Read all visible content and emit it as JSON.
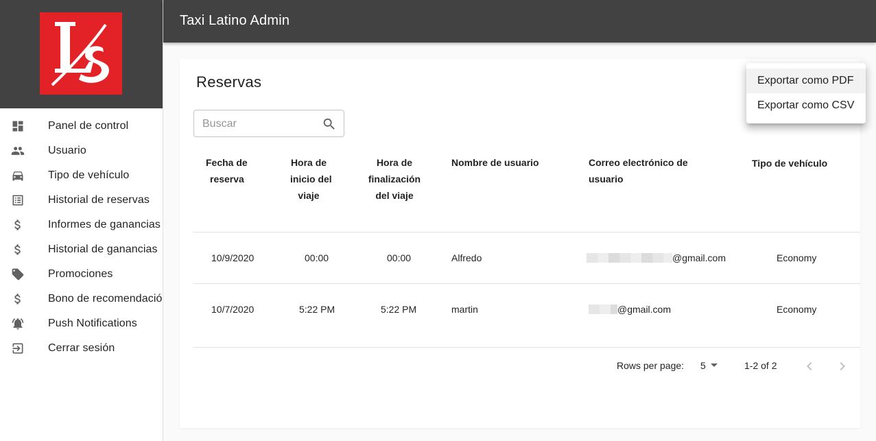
{
  "app": {
    "title": "Taxi Latino Admin"
  },
  "logo": {
    "text": "LS",
    "color": "#e32227"
  },
  "sidebar": {
    "items": [
      {
        "label": "Panel de control",
        "icon": "dashboard-icon"
      },
      {
        "label": "Usuario",
        "icon": "people-icon"
      },
      {
        "label": "Tipo de vehículo",
        "icon": "car-icon"
      },
      {
        "label": "Historial de reservas",
        "icon": "list-icon"
      },
      {
        "label": "Informes de ganancias",
        "icon": "dollar-icon"
      },
      {
        "label": "Historial de ganancias",
        "icon": "dollar-icon"
      },
      {
        "label": "Promociones",
        "icon": "tag-icon"
      },
      {
        "label": "Bono de recomendació",
        "icon": "dollar-icon"
      },
      {
        "label": "Push Notifications",
        "icon": "bell-icon"
      },
      {
        "label": "Cerrar sesión",
        "icon": "logout-icon"
      }
    ]
  },
  "page": {
    "title": "Reservas"
  },
  "search": {
    "placeholder": "Buscar",
    "value": ""
  },
  "table": {
    "headers": {
      "fecha": [
        "Fecha de",
        "reserva"
      ],
      "inicio": [
        "Hora de",
        "inicio del",
        "viaje"
      ],
      "fin": [
        "Hora de",
        "finalización",
        "del viaje"
      ],
      "nombre": [
        "Nombre de usuario"
      ],
      "correo": [
        "Correo electrónico de",
        "usuario"
      ],
      "tipo": [
        "Tipo de vehículo"
      ]
    },
    "rows": [
      {
        "fecha": "10/9/2020",
        "inicio": "00:00",
        "fin": "00:00",
        "nombre": "Alfredo",
        "correo": "@gmail.com",
        "tipo": "Economy"
      },
      {
        "fecha": "10/7/2020",
        "inicio": "5:22 PM",
        "fin": "5:22 PM",
        "nombre": "martin",
        "correo": "@gmail.com",
        "tipo": "Economy"
      }
    ]
  },
  "pagination": {
    "rows_per_page_label": "Rows per page:",
    "rows_per_page": "5",
    "range": "1-2 of 2"
  },
  "export_menu": {
    "items": [
      "Exportar como PDF",
      "Exportar como CSV"
    ]
  }
}
